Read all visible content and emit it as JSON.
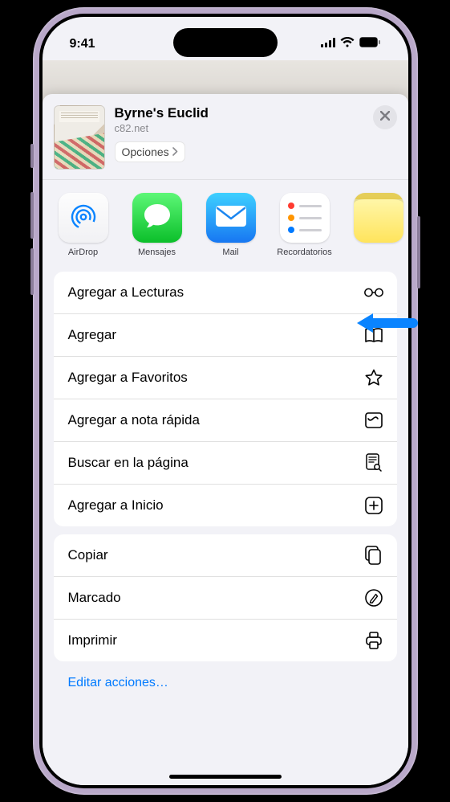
{
  "status": {
    "time": "9:41"
  },
  "header": {
    "title": "Byrne's Euclid",
    "subtitle": "c82.net",
    "options_label": "Opciones"
  },
  "apps": [
    {
      "label": "AirDrop",
      "icon": "airdrop"
    },
    {
      "label": "Mensajes",
      "icon": "messages"
    },
    {
      "label": "Mail",
      "icon": "mail"
    },
    {
      "label": "Recordatorios",
      "icon": "reminders"
    },
    {
      "label": "",
      "icon": "notes"
    }
  ],
  "actions_primary": [
    {
      "label": "Agregar a Lecturas",
      "icon": "glasses"
    },
    {
      "label": "Agregar",
      "icon": "book"
    },
    {
      "label": "Agregar a Favoritos",
      "icon": "star"
    },
    {
      "label": "Agregar a nota rápida",
      "icon": "quicknote"
    },
    {
      "label": "Buscar en la página",
      "icon": "findpage"
    },
    {
      "label": "Agregar a Inicio",
      "icon": "addhome"
    }
  ],
  "actions_secondary": [
    {
      "label": "Copiar",
      "icon": "copy"
    },
    {
      "label": "Marcado",
      "icon": "markup"
    },
    {
      "label": "Imprimir",
      "icon": "print"
    }
  ],
  "edit_actions_label": "Editar acciones…"
}
